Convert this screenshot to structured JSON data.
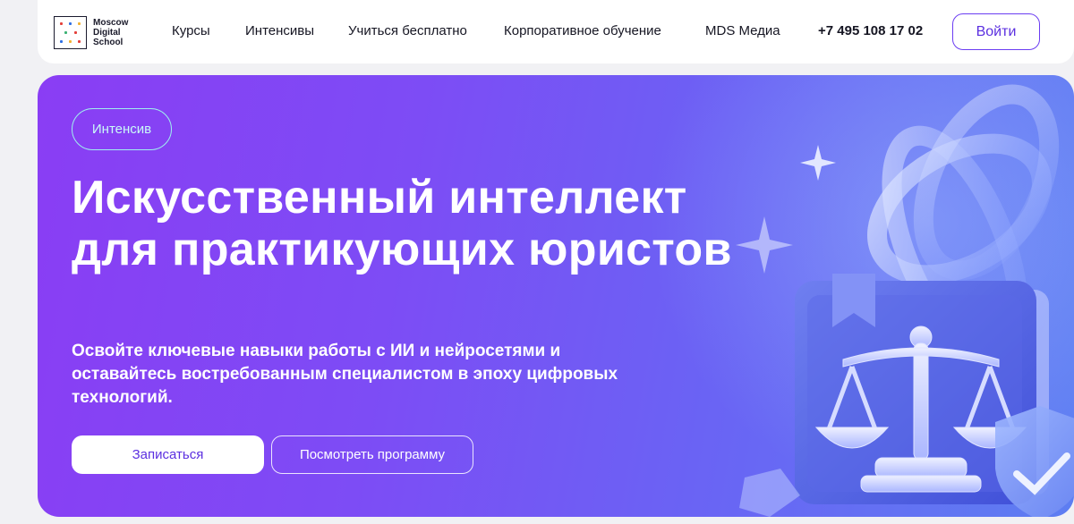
{
  "header": {
    "logo_lines": [
      "Moscow",
      "Digital",
      "School"
    ],
    "nav": [
      "Курсы",
      "Интенсивы",
      "Учиться бесплатно",
      "Корпоративное обучение",
      "MDS Медиа"
    ],
    "phone": "+7 495 108 17 02",
    "login_label": "Войти"
  },
  "hero": {
    "tag": "Интенсив",
    "title": "Искусственный интеллект для практикующих юристов",
    "subtitle": "Освойте ключевые навыки работы с ИИ и нейросетями и оставайтесь востребованным специалистом в эпоху цифровых технологий.",
    "primary_button": "Записаться",
    "secondary_button": "Посмотреть программу"
  },
  "colors": {
    "accent": "#5b2fe0",
    "hero_gradient_start": "#8a3df4",
    "hero_gradient_end": "#5d7ef2",
    "tag_border": "#9ff0ee"
  },
  "icons": [
    "logo-mark-icon",
    "sparkle-icon",
    "scales-of-justice-icon",
    "book-icon",
    "shield-check-icon",
    "glass-ring-icon"
  ]
}
